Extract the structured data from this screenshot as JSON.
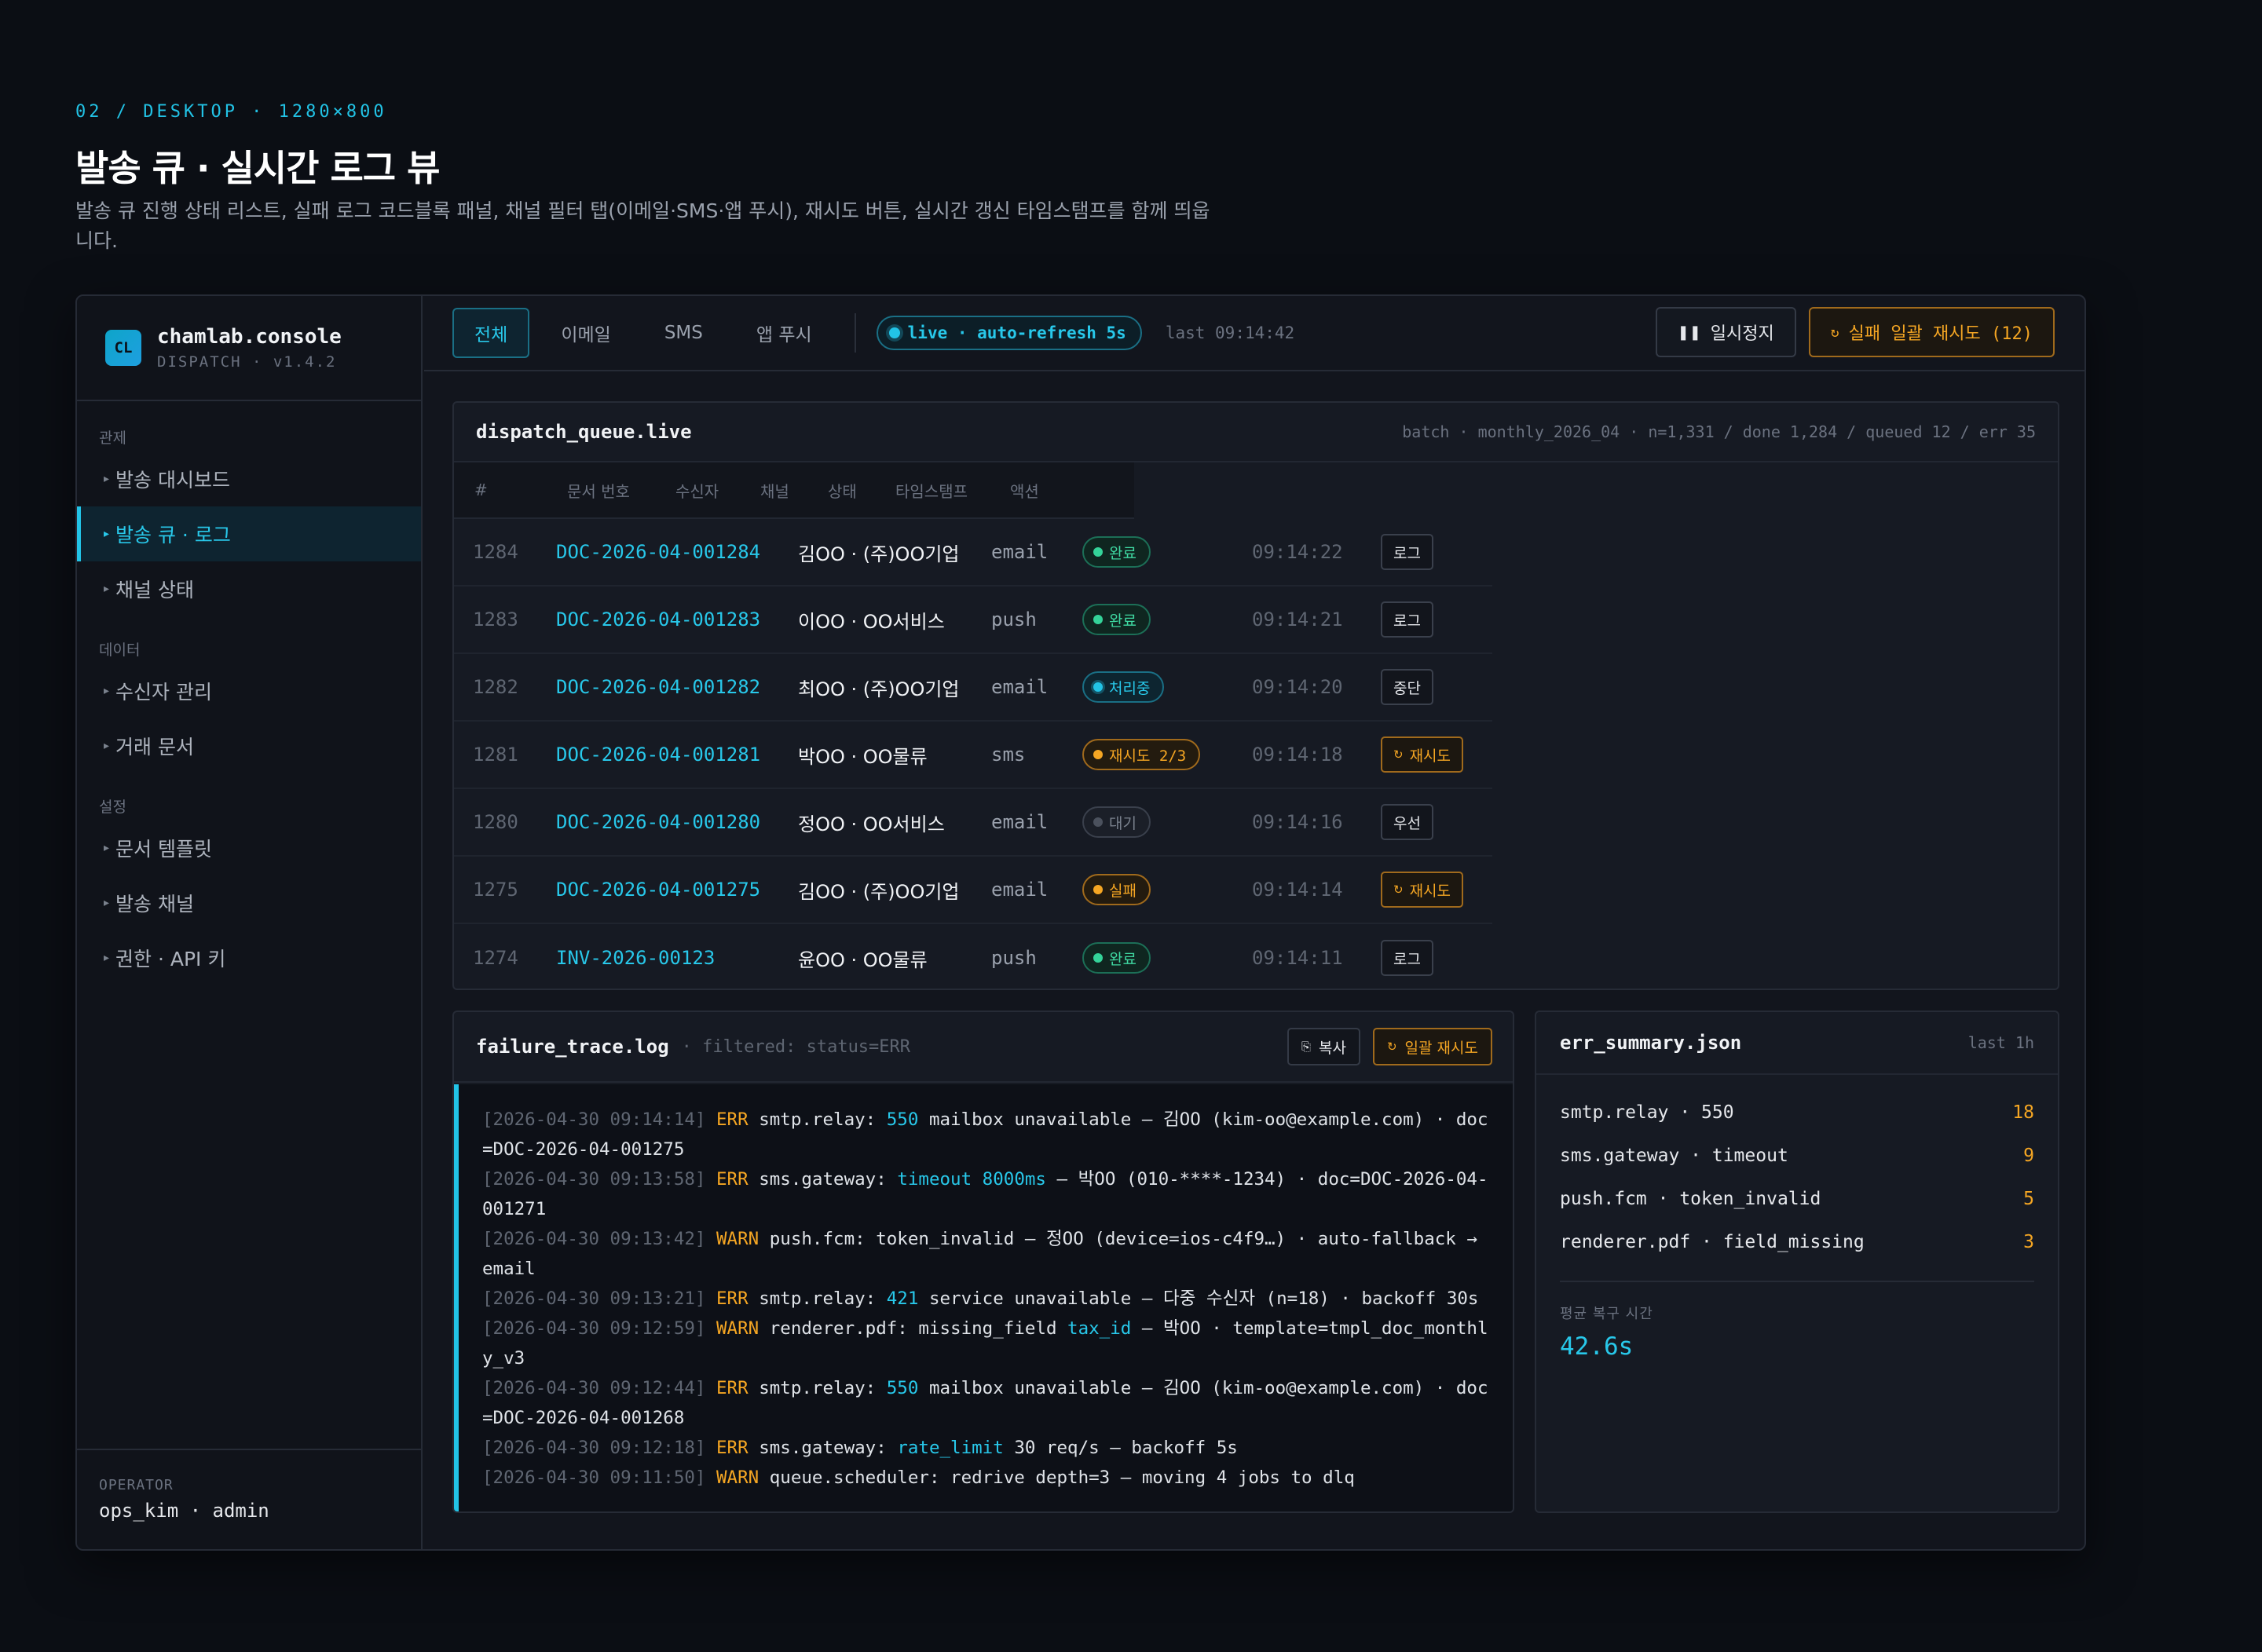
{
  "header": {
    "eyebrow": "02 / DESKTOP · 1280×800",
    "title": "발송 큐 · 실시간 로그 뷰",
    "description": "발송 큐 진행 상태 리스트, 실패 로그 코드블록 패널, 채널 필터 탭(이메일·SMS·앱 푸시), 재시도 버튼, 실시간 갱신 타임스탬프를 함께 띄웁니다."
  },
  "brand": {
    "logo": "CL",
    "name": "chamlab.console",
    "sub": "DISPATCH · v1.4.2"
  },
  "sidebar": {
    "sections": [
      {
        "heading": "관제",
        "items": [
          "발송 대시보드",
          "발송 큐 · 로그",
          "채널 상태"
        ]
      },
      {
        "heading": "데이터",
        "items": [
          "수신자 관리",
          "거래 문서"
        ]
      },
      {
        "heading": "설정",
        "items": [
          "문서 템플릿",
          "발송 채널",
          "권한 · API 키"
        ]
      }
    ],
    "active_item": "발송 큐 · 로그",
    "operator_label": "OPERATOR",
    "operator_value": "ops_kim · admin"
  },
  "topbar": {
    "tabs": [
      "전체",
      "이메일",
      "SMS",
      "앱 푸시"
    ],
    "active_tab": "전체",
    "live_label": "live · auto-refresh 5s",
    "last_updated": "last 09:14:42",
    "pause_label": "일시정지",
    "pause_icon": "pause-icon",
    "retry_all_label": "실패 일괄 재시도 (12)",
    "retry_icon": "refresh-icon"
  },
  "queue": {
    "title": "dispatch_queue.live",
    "meta": "batch · monthly_2026_04 · n=1,331 / done 1,284 / queued 12 / err 35",
    "columns": [
      "#",
      "문서 번호",
      "수신자",
      "채널",
      "상태",
      "타임스탬프",
      "액션"
    ],
    "rows": [
      {
        "num": "1284",
        "doc": "DOC-2026-04-001284",
        "recipient": "김OO · (주)OO기업",
        "channel": "email",
        "status": "완료",
        "status_type": "done",
        "time": "09:14:22",
        "action": "로그",
        "action_type": "normal"
      },
      {
        "num": "1283",
        "doc": "DOC-2026-04-001283",
        "recipient": "이OO · OO서비스",
        "channel": "push",
        "status": "완료",
        "status_type": "done",
        "time": "09:14:21",
        "action": "로그",
        "action_type": "normal"
      },
      {
        "num": "1282",
        "doc": "DOC-2026-04-001282",
        "recipient": "최OO · (주)OO기업",
        "channel": "email",
        "status": "처리중",
        "status_type": "proc",
        "time": "09:14:20",
        "action": "중단",
        "action_type": "normal"
      },
      {
        "num": "1281",
        "doc": "DOC-2026-04-001281",
        "recipient": "박OO · OO물류",
        "channel": "sms",
        "status": "재시도 2/3",
        "status_type": "retry",
        "time": "09:14:18",
        "action": "재시도",
        "action_type": "warn"
      },
      {
        "num": "1280",
        "doc": "DOC-2026-04-001280",
        "recipient": "정OO · OO서비스",
        "channel": "email",
        "status": "대기",
        "status_type": "wait",
        "time": "09:14:16",
        "action": "우선",
        "action_type": "normal"
      },
      {
        "num": "1275",
        "doc": "DOC-2026-04-001275",
        "recipient": "김OO · (주)OO기업",
        "channel": "email",
        "status": "실패",
        "status_type": "fail",
        "time": "09:14:14",
        "action": "재시도",
        "action_type": "warn"
      },
      {
        "num": "1274",
        "doc": "INV-2026-00123",
        "recipient": "윤OO · OO물류",
        "channel": "push",
        "status": "완료",
        "status_type": "done",
        "time": "09:14:11",
        "action": "로그",
        "action_type": "normal"
      }
    ]
  },
  "trace": {
    "title": "failure_trace.log",
    "filter": "· filtered: status=ERR",
    "copy_label": "복사",
    "copy_icon": "copy-icon",
    "retry_label": "일괄 재시도",
    "lines": [
      {
        "ts": "[2026-04-30 09:14:14]",
        "level": "ERR",
        "parts": [
          [
            "smtp.relay: ",
            ""
          ],
          [
            "550",
            "hl"
          ],
          [
            " mailbox unavailable — 김OO (kim-oo@example.com) · doc=DOC-2026-04-001275",
            ""
          ]
        ]
      },
      {
        "ts": "[2026-04-30 09:13:58]",
        "level": "ERR",
        "parts": [
          [
            "sms.gateway: ",
            ""
          ],
          [
            "timeout 8000ms",
            "hl"
          ],
          [
            " — 박OO (010-****-1234) · doc=DOC-2026-04-001271",
            ""
          ]
        ]
      },
      {
        "ts": "[2026-04-30 09:13:42]",
        "level": "WARN",
        "parts": [
          [
            "push.fcm: token_invalid — 정OO (device=ios-c4f9…) · auto-fallback → email",
            ""
          ]
        ]
      },
      {
        "ts": "[2026-04-30 09:13:21]",
        "level": "ERR",
        "parts": [
          [
            "smtp.relay: ",
            ""
          ],
          [
            "421",
            "hl"
          ],
          [
            " service unavailable — 다중 수신자 (n=18) · backoff 30s",
            ""
          ]
        ]
      },
      {
        "ts": "[2026-04-30 09:12:59]",
        "level": "WARN",
        "parts": [
          [
            "renderer.pdf: missing_field ",
            ""
          ],
          [
            "tax_id",
            "hl"
          ],
          [
            " — 박OO · template=tmpl_doc_monthly_v3",
            ""
          ]
        ]
      },
      {
        "ts": "[2026-04-30 09:12:44]",
        "level": "ERR",
        "parts": [
          [
            "smtp.relay: ",
            ""
          ],
          [
            "550",
            "hl"
          ],
          [
            " mailbox unavailable — 김OO (kim-oo@example.com) · doc=DOC-2026-04-001268",
            ""
          ]
        ]
      },
      {
        "ts": "[2026-04-30 09:12:18]",
        "level": "ERR",
        "parts": [
          [
            "sms.gateway: ",
            ""
          ],
          [
            "rate_limit",
            "hl"
          ],
          [
            " 30 req/s — backoff 5s",
            ""
          ]
        ]
      },
      {
        "ts": "[2026-04-30 09:11:50]",
        "level": "WARN",
        "parts": [
          [
            "queue.scheduler: redrive depth=3 — moving 4 jobs to dlq",
            ""
          ]
        ]
      }
    ]
  },
  "errors": {
    "title": "err_summary.json",
    "range": "last 1h",
    "items": [
      {
        "name": "smtp.relay · 550",
        "count": "18"
      },
      {
        "name": "sms.gateway · timeout",
        "count": "9"
      },
      {
        "name": "push.fcm · token_invalid",
        "count": "5"
      },
      {
        "name": "renderer.pdf · field_missing",
        "count": "3"
      }
    ],
    "mttr_label": "평균 복구 시간",
    "mttr_value": "42.6s"
  },
  "colors": {
    "accent": "#22c3e6",
    "warning": "#f5a623",
    "success": "#34d399",
    "background": "#0b0e14"
  }
}
